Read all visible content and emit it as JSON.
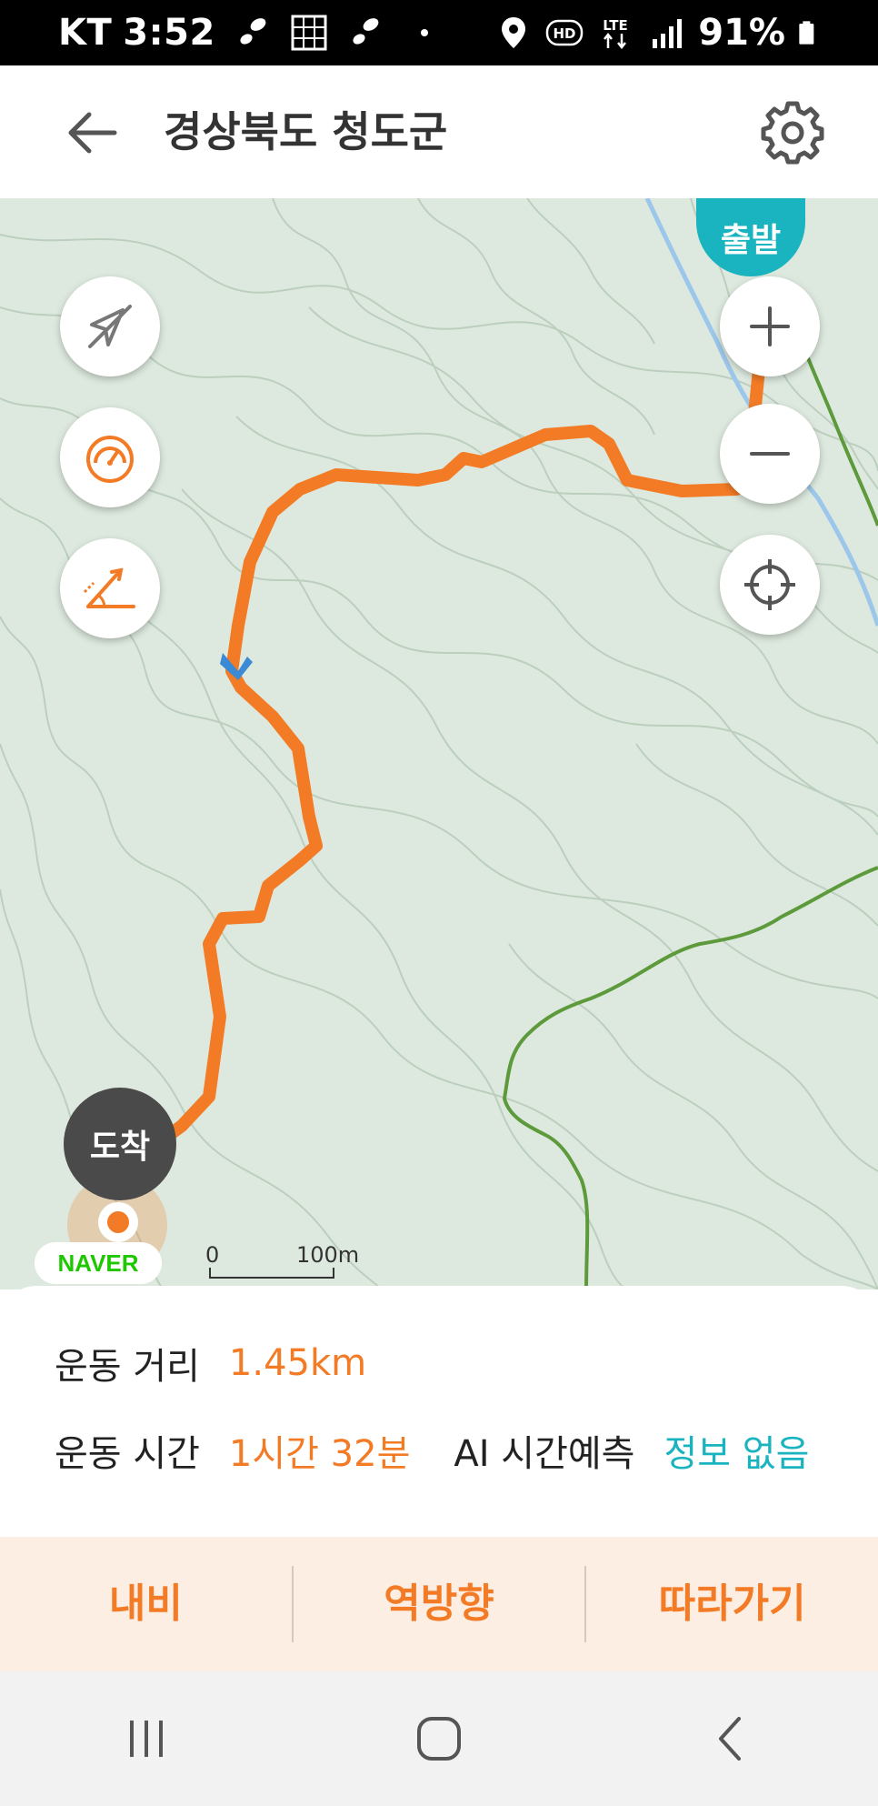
{
  "status_bar": {
    "carrier": "KT",
    "time": "3:52",
    "battery": "91%",
    "icons": [
      "shoe-print-icon",
      "grid-icon",
      "shoe-print-icon",
      "location-icon",
      "hd-icon",
      "lte-icon",
      "signal-icon",
      "battery-icon"
    ]
  },
  "header": {
    "title": "경상북도 청도군",
    "back_icon": "arrow-left-icon",
    "settings_icon": "gear-icon"
  },
  "map": {
    "start_label": "출발",
    "end_label": "도착",
    "provider": "NAVER",
    "scale_zero": "0",
    "scale_label": "100m",
    "controls_left": [
      "compass-off-icon",
      "speedometer-icon",
      "slope-icon"
    ],
    "controls_right": [
      "zoom-in-icon",
      "zoom-out-icon",
      "locate-icon"
    ],
    "route_color": "#f37b25",
    "start_color": "#19b4bf"
  },
  "info": {
    "distance_label": "운동 거리",
    "distance_value": "1.45km",
    "time_label": "운동 시간",
    "time_value": "1시간 32분",
    "ai_label": "AI 시간예측",
    "ai_value": "정보 없음"
  },
  "actions": {
    "navi": "내비",
    "reverse": "역방향",
    "follow": "따라가기"
  },
  "nav_bar": [
    "recent-apps-icon",
    "home-icon",
    "back-icon"
  ]
}
